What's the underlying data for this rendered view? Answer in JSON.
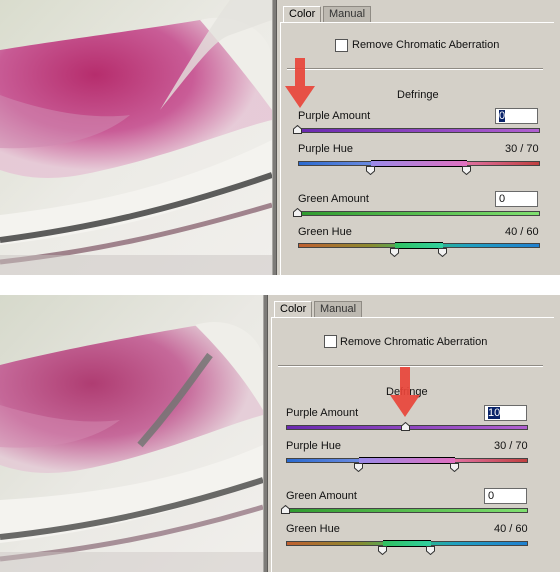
{
  "tabs": [
    {
      "label": "Color",
      "active": true
    },
    {
      "label": "Manual",
      "active": false
    }
  ],
  "checkbox": {
    "label": "Remove Chromatic Aberration",
    "checked": false
  },
  "section_title": "Defringe",
  "panels": [
    {
      "purple_amount": {
        "label": "Purple Amount",
        "value": "0",
        "fraction": 0.0
      },
      "purple_hue": {
        "label": "Purple Hue",
        "value": "30 / 70",
        "low": 30,
        "high": 70
      },
      "green_amount": {
        "label": "Green Amount",
        "value": "0",
        "fraction": 0.0
      },
      "green_hue": {
        "label": "Green Hue",
        "value": "40 / 60",
        "low": 40,
        "high": 60
      }
    },
    {
      "purple_amount": {
        "label": "Purple Amount",
        "value": "10",
        "fraction": 0.5
      },
      "purple_hue": {
        "label": "Purple Hue",
        "value": "30 / 70",
        "low": 30,
        "high": 70
      },
      "green_amount": {
        "label": "Green Amount",
        "value": "0",
        "fraction": 0.0
      },
      "green_hue": {
        "label": "Green Hue",
        "value": "40 / 60",
        "low": 40,
        "high": 60
      }
    }
  ],
  "icons": {
    "pointer": "red-arrow-icon",
    "thumb": "slider-thumb-icon"
  },
  "colors": {
    "panel_bg": "#d4d0c8",
    "purple_track": "#9a3fbf",
    "green_track": "#3fbf3f",
    "arrow": "#e8443a",
    "fringe_magenta": "#b8357a"
  }
}
